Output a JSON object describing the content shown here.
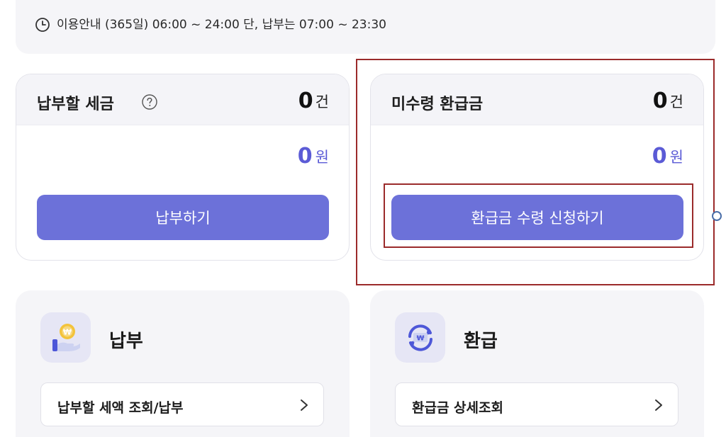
{
  "notice": {
    "text": "이용안내 (365일) 06:00 ~ 24:00 단, 납부는 07:00 ~ 23:30",
    "icon": "clock-icon"
  },
  "tax_card": {
    "title": "납부할 세금",
    "count": "0",
    "count_unit": "건",
    "amount": "0",
    "amount_unit": "원",
    "button_label": "납부하기",
    "help_icon": "help-circle-icon"
  },
  "refund_card": {
    "title": "미수령 환급금",
    "count": "0",
    "count_unit": "건",
    "amount": "0",
    "amount_unit": "원",
    "button_label": "환급금 수령 신청하기"
  },
  "payment_panel": {
    "title": "납부",
    "icon": "coin-hand-icon",
    "link_label": "납부할 세액 조회/납부"
  },
  "refund_panel": {
    "title": "환급",
    "icon": "refund-exchange-icon",
    "link_label": "환급금 상세조회"
  },
  "colors": {
    "accent": "#6c71d9",
    "amount": "#5b5bd6",
    "highlight_border": "#9b2b2b",
    "panel_bg": "#f5f5f8"
  }
}
